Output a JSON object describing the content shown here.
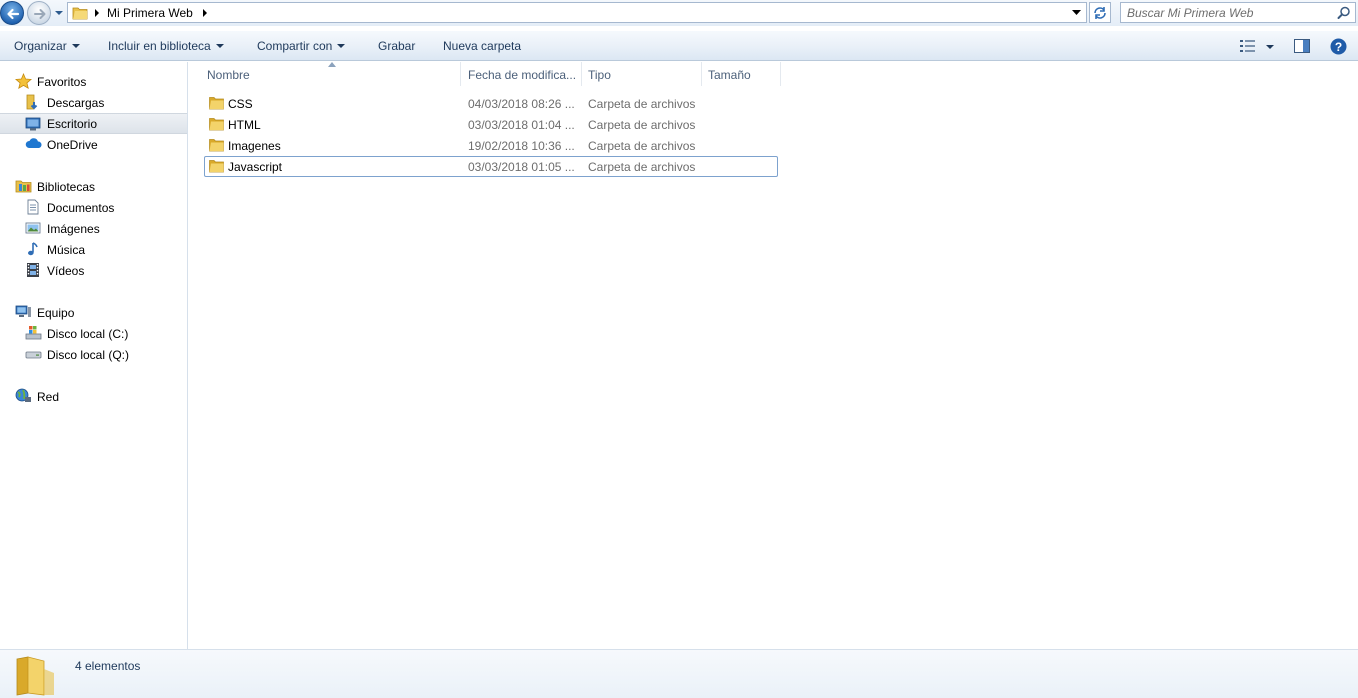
{
  "address": {
    "breadcrumb": "Mi Primera Web",
    "search_placeholder": "Buscar Mi Primera Web"
  },
  "commands": {
    "organize": "Organizar",
    "include_library": "Incluir en biblioteca",
    "share_with": "Compartir con",
    "burn": "Grabar",
    "new_folder": "Nueva carpeta"
  },
  "nav": {
    "favorites": "Favoritos",
    "downloads": "Descargas",
    "desktop": "Escritorio",
    "onedrive": "OneDrive",
    "libraries": "Bibliotecas",
    "documents": "Documentos",
    "pictures": "Imágenes",
    "music": "Música",
    "videos": "Vídeos",
    "computer": "Equipo",
    "disk_c": "Disco local (C:)",
    "disk_q": "Disco local (Q:)",
    "network": "Red"
  },
  "columns": {
    "name": "Nombre",
    "date": "Fecha de modifica...",
    "type": "Tipo",
    "size": "Tamaño"
  },
  "files": [
    {
      "name": "CSS",
      "date": "04/03/2018 08:26 ...",
      "type": "Carpeta de archivos",
      "size": ""
    },
    {
      "name": "HTML",
      "date": "03/03/2018 01:04 ...",
      "type": "Carpeta de archivos",
      "size": ""
    },
    {
      "name": "Imagenes",
      "date": "19/02/2018 10:36 ...",
      "type": "Carpeta de archivos",
      "size": ""
    },
    {
      "name": "Javascript",
      "date": "03/03/2018 01:05 ...",
      "type": "Carpeta de archivos",
      "size": ""
    }
  ],
  "status": {
    "count": "4 elementos"
  },
  "colors": {
    "accent_text": "#1e395b",
    "selection_border": "#7da2ce",
    "folder": "#e8c14a"
  },
  "icons": {
    "back": "back-arrow-icon",
    "forward": "forward-arrow-icon",
    "folder": "folder-icon",
    "search": "search-icon",
    "refresh": "refresh-icon",
    "help": "help-icon"
  }
}
